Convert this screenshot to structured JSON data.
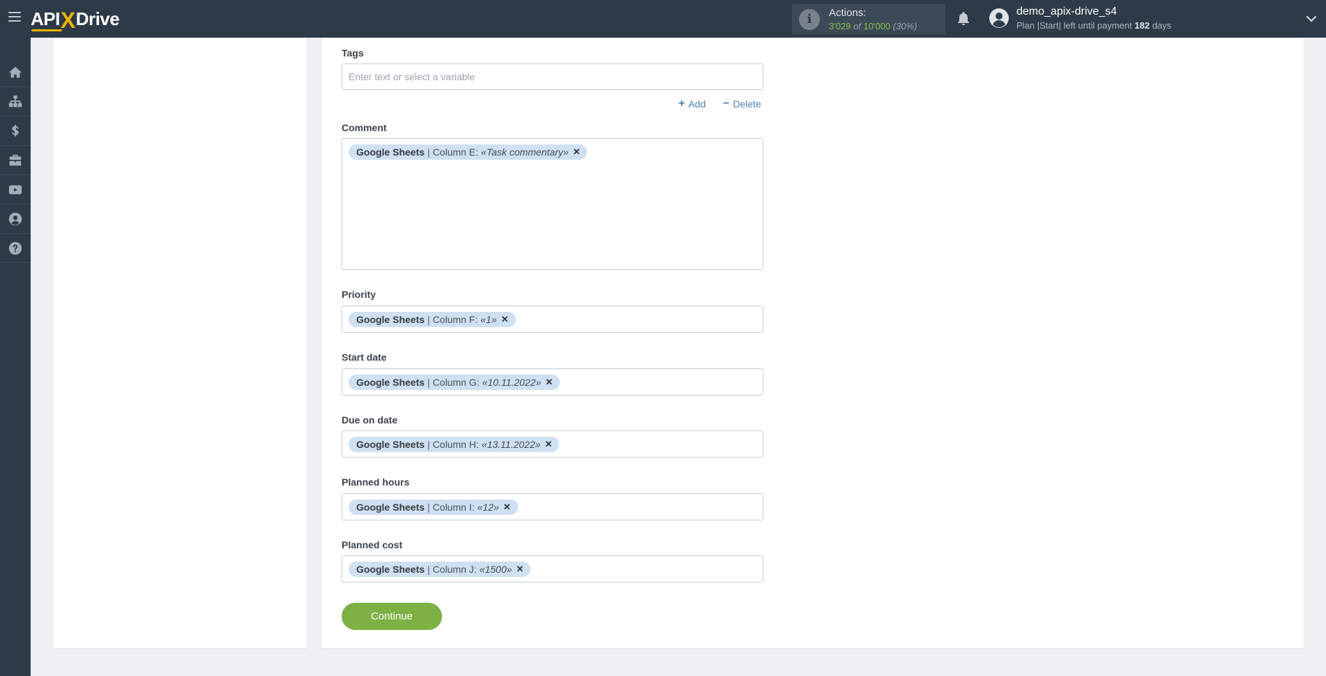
{
  "header": {
    "logo": {
      "left": "API",
      "x": "X",
      "right": "Drive"
    },
    "actions": {
      "label": "Actions:",
      "used": "3'029",
      "of": "of",
      "total": "10'000",
      "percent": "(30%)"
    },
    "user": {
      "name": "demo_apix-drive_s4",
      "plan_prefix": "Plan |Start| left until payment",
      "days": "182",
      "days_suffix": "days"
    }
  },
  "sidenav": {
    "items": [
      "home-icon",
      "sitemap-icon",
      "dollar-icon",
      "briefcase-icon",
      "video-icon",
      "user-circle-icon",
      "help-icon"
    ]
  },
  "form": {
    "tags": {
      "label": "Tags",
      "placeholder": "Enter text or select a variable"
    },
    "add_label": "Add",
    "delete_label": "Delete",
    "fields": [
      {
        "label": "Comment",
        "source": "Google Sheets",
        "column": "Column E:",
        "value": "«Task commentary»"
      },
      {
        "label": "Priority",
        "source": "Google Sheets",
        "column": "Column F:",
        "value": "«1»"
      },
      {
        "label": "Start date",
        "source": "Google Sheets",
        "column": "Column G:",
        "value": "«10.11.2022»"
      },
      {
        "label": "Due on date",
        "source": "Google Sheets",
        "column": "Column H:",
        "value": "«13.11.2022»"
      },
      {
        "label": "Planned hours",
        "source": "Google Sheets",
        "column": "Column I:",
        "value": "«12»"
      },
      {
        "label": "Planned cost",
        "source": "Google Sheets",
        "column": "Column J:",
        "value": "«1500»"
      }
    ],
    "continue_label": "Continue"
  },
  "colors": {
    "topbar": "#2d3a47",
    "accent_green": "#7db144",
    "chip": "#cfe0f2",
    "link": "#4c7fb8"
  }
}
